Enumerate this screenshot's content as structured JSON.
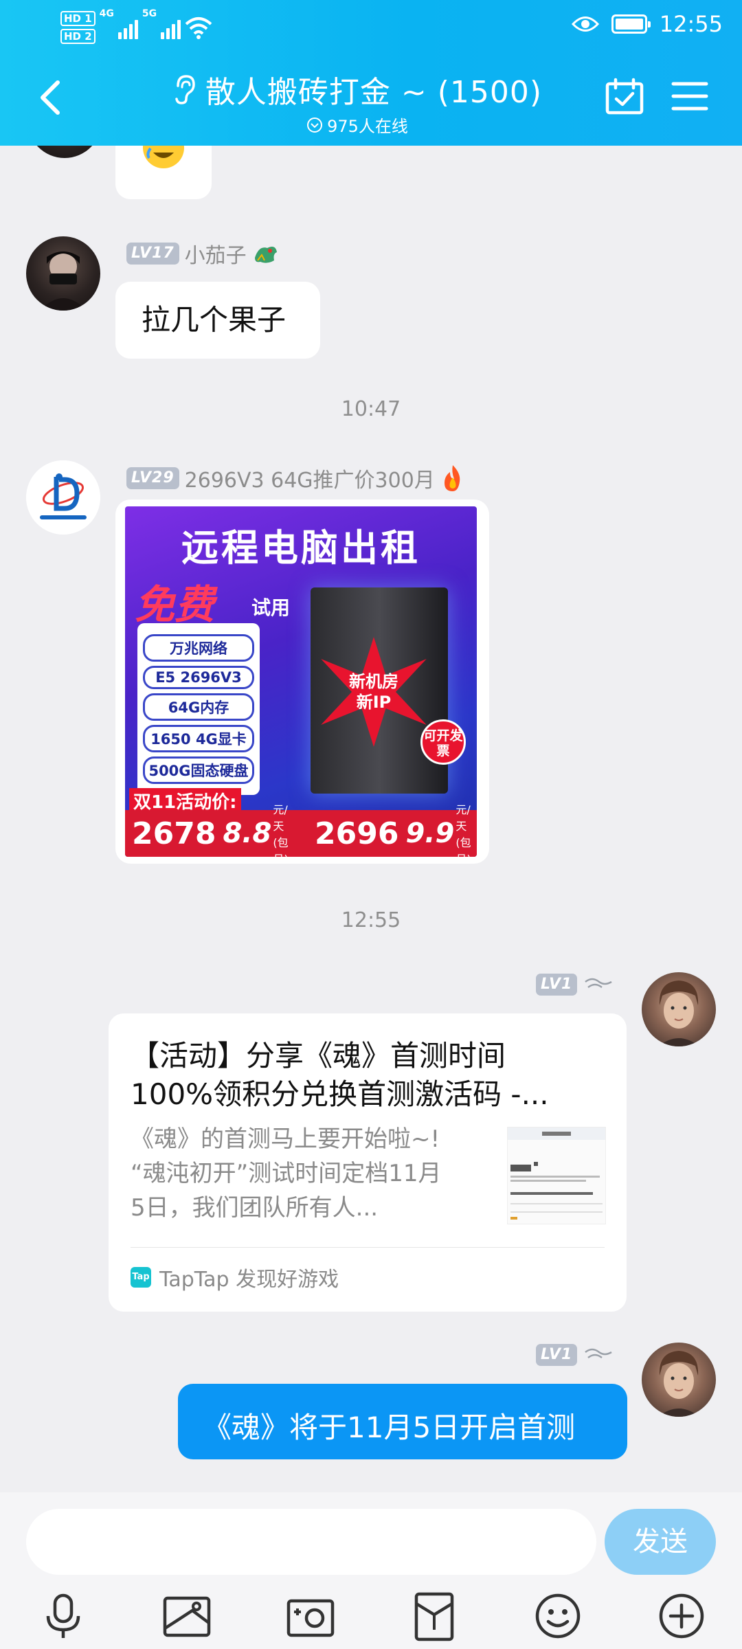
{
  "status_bar": {
    "hd1": "HD 1",
    "hd2": "HD 2",
    "network": "4G",
    "network2": "5G",
    "time": "12:55"
  },
  "header": {
    "title": "散人搬砖打金 ~ (1500)",
    "online": "975人在线"
  },
  "messages": {
    "m1": {
      "level": "LV17",
      "nickname": "小茄子",
      "text": "拉几个果子"
    },
    "ts1": "10:47",
    "m2": {
      "level": "LV29",
      "nickname": "2696V3 64G推广价300月",
      "ad": {
        "title": "远程电脑出租",
        "free": "免费",
        "free_sub": "试用",
        "items": [
          "万兆网络",
          "E5 2696V3",
          "64G内存",
          "1650 4G显卡",
          "500G固态硬盘"
        ],
        "badge_line1": "新机房",
        "badge_line2": "新IP",
        "invoice": "可开发票",
        "promo_label": "双11活动价:",
        "price1": "2678",
        "daily1": "8.8",
        "price2": "2696",
        "daily2": "9.9",
        "unit": "元/天",
        "unit_note": "(包月)"
      }
    },
    "ts2": "12:55",
    "m3": {
      "level": "LV1",
      "card": {
        "title_line1": "【活动】分享《魂》首测时间",
        "title_line2": "100%领积分兑换首测激活码 -...",
        "desc_line1": "《魂》的首测马上要开始啦~!",
        "desc_line2": "“魂沌初开”测试时间定档11月",
        "desc_line3": "5日，我们团队所有人...",
        "source_logo": "Tap",
        "source": "TapTap 发现好游戏"
      }
    },
    "m4": {
      "level": "LV1",
      "text": "《魂》将于11月5日开启首测"
    }
  },
  "input": {
    "placeholder": "",
    "send_label": "发送"
  },
  "colors": {
    "header": "#0ab3f2",
    "outgoing_bubble": "#0b96f5",
    "send_button": "#8dcff6"
  },
  "icons": [
    "back-icon",
    "ear-icon",
    "calendar-check-icon",
    "menu-icon",
    "mic-icon",
    "image-icon",
    "camera-icon",
    "red-packet-icon",
    "emoji-icon",
    "plus-icon"
  ]
}
